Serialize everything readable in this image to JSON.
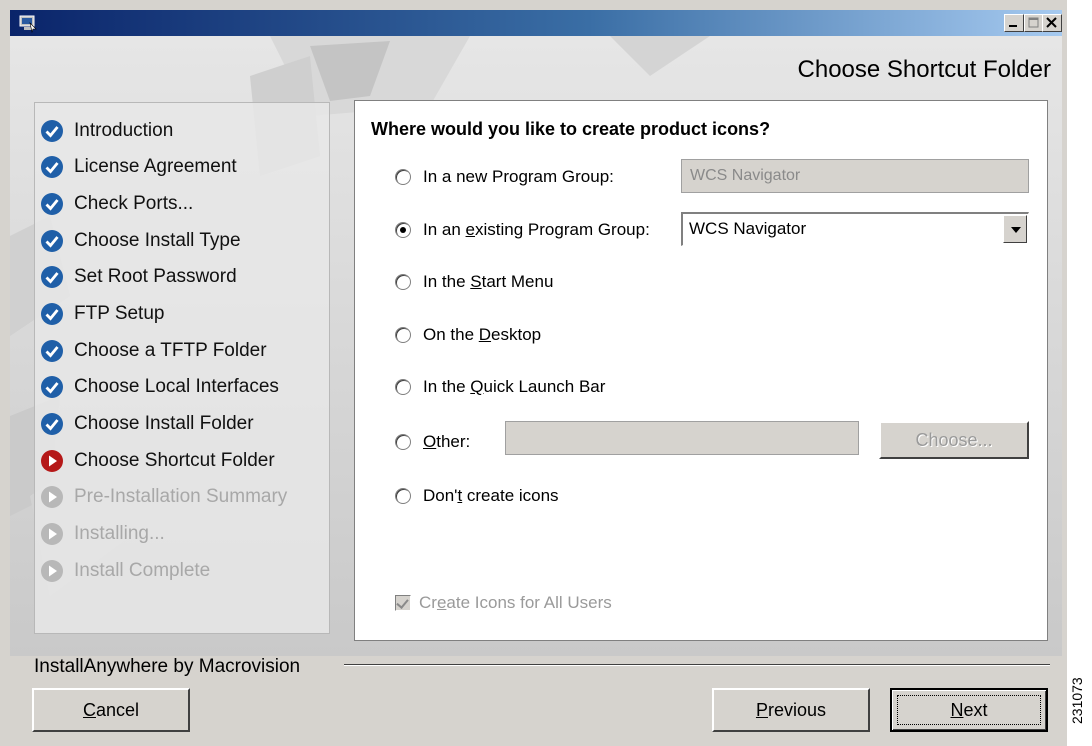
{
  "window": {
    "title_buttons": [
      "minimize-icon",
      "maximize-icon",
      "close-icon"
    ]
  },
  "header": {
    "title": "Choose Shortcut Folder"
  },
  "steps": [
    {
      "label": "Introduction",
      "status": "done"
    },
    {
      "label": "License Agreement",
      "status": "done"
    },
    {
      "label": "Check Ports...",
      "status": "done"
    },
    {
      "label": "Choose Install Type",
      "status": "done"
    },
    {
      "label": "Set Root Password",
      "status": "done"
    },
    {
      "label": "FTP Setup",
      "status": "done"
    },
    {
      "label": "Choose a TFTP Folder",
      "status": "done"
    },
    {
      "label": "Choose Local Interfaces",
      "status": "done"
    },
    {
      "label": "Choose Install Folder",
      "status": "done"
    },
    {
      "label": "Choose Shortcut Folder",
      "status": "current"
    },
    {
      "label": "Pre-Installation Summary",
      "status": "pending"
    },
    {
      "label": "Installing...",
      "status": "pending"
    },
    {
      "label": "Install Complete",
      "status": "pending"
    }
  ],
  "content": {
    "question": "Where would you like to create product icons?",
    "options": {
      "new_group": {
        "label": "In a new Program Group:",
        "value": "WCS Navigator",
        "selected": false
      },
      "existing_group": {
        "pre": "In an ",
        "mnemonic": "e",
        "post": "xisting Program Group:",
        "value": "WCS Navigator",
        "selected": true
      },
      "start_menu": {
        "pre": "In the ",
        "mnemonic": "S",
        "post": "tart Menu",
        "selected": false
      },
      "desktop": {
        "pre": "On the ",
        "mnemonic": "D",
        "post": "esktop",
        "selected": false
      },
      "quick_launch": {
        "pre": "In the ",
        "mnemonic": "Q",
        "post": "uick Launch Bar",
        "selected": false
      },
      "other": {
        "pre": "",
        "mnemonic": "O",
        "post": "ther:",
        "value": "",
        "selected": false
      },
      "no_icons": {
        "pre": "Don'",
        "mnemonic": "t",
        "post": " create icons",
        "selected": false
      }
    },
    "choose_button": "Choose...",
    "all_users": {
      "pre": "Cr",
      "mnemonic": "e",
      "post": "ate Icons for All Users",
      "checked": true,
      "enabled": false
    }
  },
  "footer": {
    "brand": "InstallAnywhere by Macrovision",
    "cancel": {
      "pre": "",
      "mnemonic": "C",
      "post": "ancel"
    },
    "previous": {
      "pre": "",
      "mnemonic": "P",
      "post": "revious"
    },
    "next": {
      "pre": "",
      "mnemonic": "N",
      "post": "ext"
    }
  },
  "figure_ref": "231073",
  "colors": {
    "titlebar_start": "#0a246a",
    "done_icon": "#1f5fa8",
    "current_icon": "#b51818",
    "pending_icon": "#b8b8b8"
  }
}
